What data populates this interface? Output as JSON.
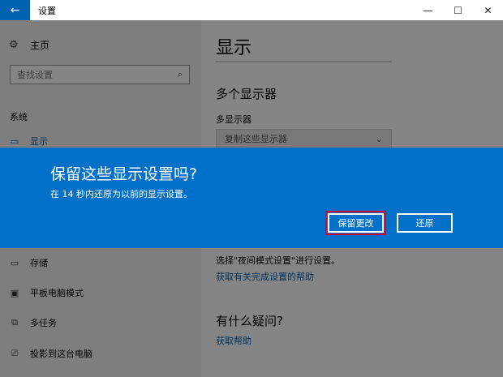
{
  "window": {
    "title": "设置",
    "back_icon": "arrow-left-icon",
    "controls": [
      "minimize-icon",
      "maximize-icon",
      "close-icon"
    ]
  },
  "sidebar": {
    "home": "主页",
    "search_placeholder": "查找设置",
    "section": "系统",
    "items": [
      {
        "label": "显示",
        "icon": "monitor-icon",
        "active": true
      },
      {
        "label": "存储",
        "icon": "storage-icon"
      },
      {
        "label": "平板电脑模式",
        "icon": "tablet-icon"
      },
      {
        "label": "多任务",
        "icon": "multitask-icon"
      },
      {
        "label": "投影到这台电脑",
        "icon": "project-icon"
      }
    ]
  },
  "main": {
    "title": "显示",
    "multi_display_heading": "多个显示器",
    "multi_display_label": "多显示器",
    "multi_display_value": "复制这些显示器",
    "nightlight_text": "选择\"夜间模式设置\"进行设置。",
    "help_link": "获取有关完成设置的帮助",
    "question_heading": "有什么疑问?",
    "get_help": "获取帮助"
  },
  "dialog": {
    "title": "保留这些显示设置吗?",
    "subtitle": "在 14 秒内还原为以前的显示设置。",
    "countdown_seconds": 14,
    "keep_button": "保留更改",
    "revert_button": "还原"
  },
  "colors": {
    "accent": "#0063b1",
    "dialog_bg": "#0070c8",
    "highlight_border": "#c50f3a"
  }
}
